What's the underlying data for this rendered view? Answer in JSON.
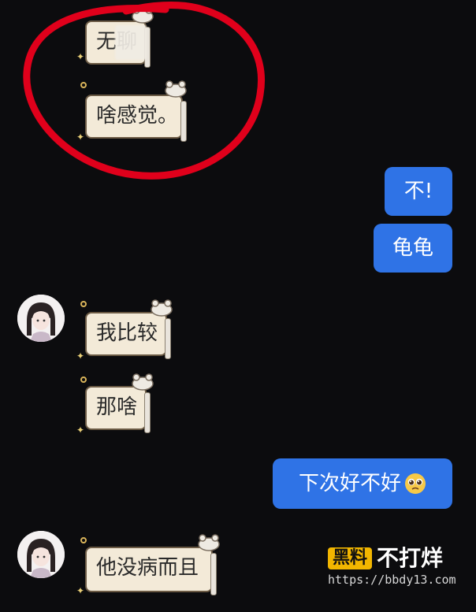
{
  "messages": {
    "in_1": "无聊",
    "in_2": "啥感觉。",
    "out_1": "不!",
    "out_2": "龟龟",
    "in_3": "我比较",
    "in_4": "那啥",
    "out_3": "下次好不好",
    "in_5": "他没病而且"
  },
  "emoji": {
    "out_3": "pleading-face-emoji"
  },
  "colors": {
    "background": "#0c0c0e",
    "outgoing_bubble": "#2f73e6",
    "incoming_bubble": "#f3ead8",
    "annotation_circle": "#e0001b",
    "watermark_logo": "#f2b600"
  },
  "watermark": {
    "logo": "黑料",
    "name": "不打烊",
    "url": "https://bbdy13.com"
  }
}
